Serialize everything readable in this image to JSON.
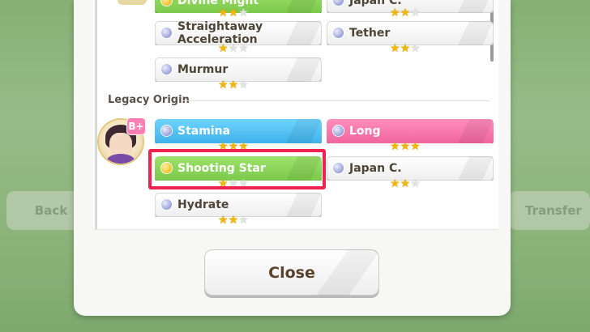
{
  "background": {
    "back_label": "Back",
    "transfer_label": "Transfer"
  },
  "skills_top": [
    {
      "label": "Divine Might",
      "style": "green",
      "stars": 2,
      "max": 3
    },
    {
      "label": "Japan C.",
      "style": "plain",
      "stars": 2,
      "max": 3
    },
    {
      "label": "Straightaway Acceleration",
      "style": "plain",
      "stars": 1,
      "max": 3
    },
    {
      "label": "Tether",
      "style": "plain",
      "stars": 2,
      "max": 3
    },
    {
      "label": "Murmur",
      "style": "plain",
      "stars": 2,
      "max": 3
    }
  ],
  "legacy": {
    "title": "Legacy Origin",
    "rank": "B+",
    "skills": [
      {
        "label": "Stamina",
        "style": "blue",
        "stars": 3,
        "max": 3
      },
      {
        "label": "Long",
        "style": "pink",
        "stars": 3,
        "max": 3
      },
      {
        "label": "Shooting Star",
        "style": "green",
        "stars": 1,
        "max": 3,
        "highlighted": true
      },
      {
        "label": "Japan C.",
        "style": "plain",
        "stars": 2,
        "max": 3
      },
      {
        "label": "Hydrate",
        "style": "plain",
        "stars": 2,
        "max": 3
      }
    ]
  },
  "close_label": "Close",
  "colors": {
    "highlight": "#f0224f",
    "star": "#f2b705"
  }
}
